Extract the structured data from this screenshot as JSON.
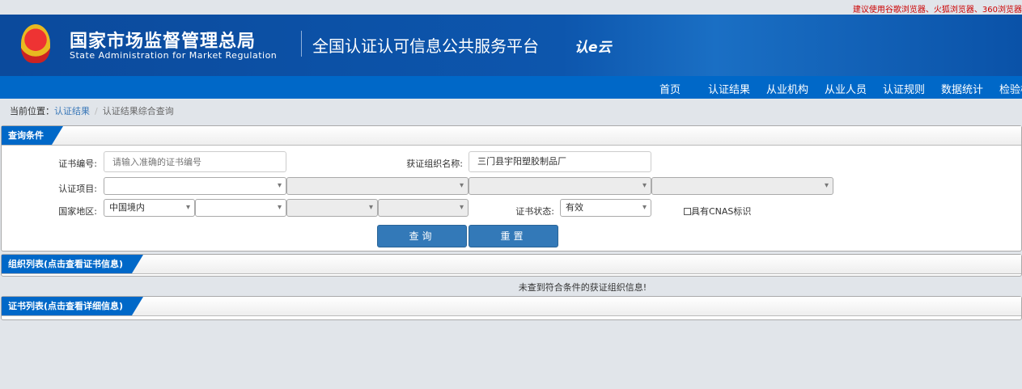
{
  "top_tip": "建议使用谷歌浏览器、火狐浏览器、360浏览器",
  "header": {
    "org_cn": "国家市场监督管理总局",
    "org_en": "State Administration  for  Market Regulation",
    "platform": "全国认证认可信息公共服务平台",
    "logo": "认e云"
  },
  "nav": [
    "首页",
    "认证结果",
    "从业机构",
    "从业人员",
    "认证规则",
    "数据统计",
    "检验检"
  ],
  "breadcrumb": {
    "prefix": "当前位置：",
    "link": "认证结果",
    "sep": "/",
    "current": "认证结果综合查询"
  },
  "query": {
    "title": "查询条件",
    "cert_no_label": "证书编号:",
    "cert_no_placeholder": "请输入准确的证书编号",
    "org_label": "获证组织名称:",
    "org_value": "三门县宇阳塑胶制品厂",
    "project_label": "认证项目:",
    "region_label": "国家地区:",
    "region_value": "中国境内",
    "status_label": "证书状态:",
    "status_value": "有效",
    "cnas_label": "具有CNAS标识",
    "search_btn": "查询",
    "reset_btn": "重置"
  },
  "org_list": {
    "title": "组织列表(点击查看证书信息)",
    "empty_msg": "未查到符合条件的获证组织信息!"
  },
  "cert_list": {
    "title": "证书列表(点击查看详细信息)"
  }
}
